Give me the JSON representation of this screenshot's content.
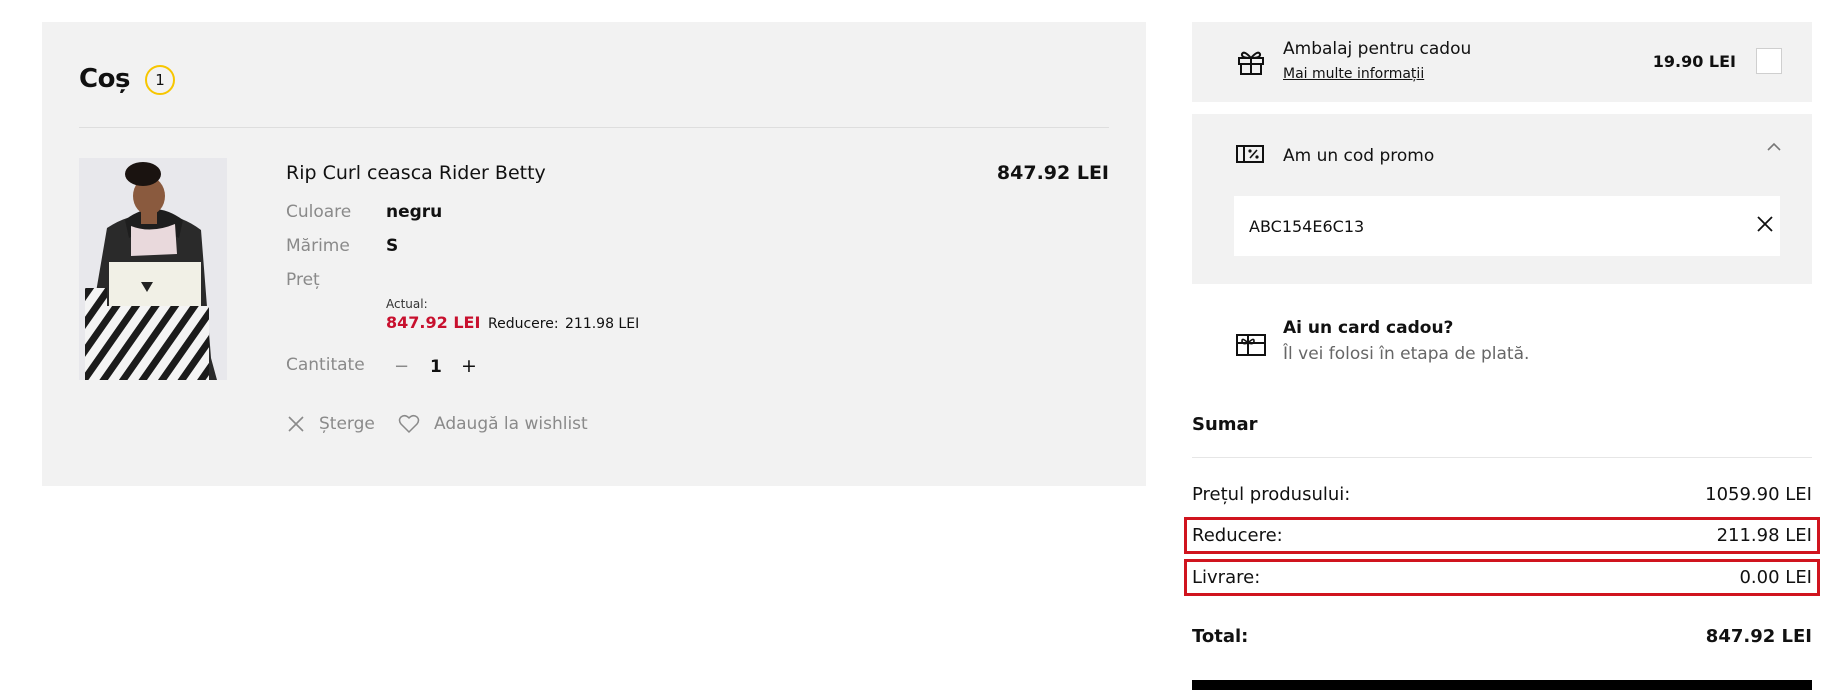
{
  "cart": {
    "title": "Coș",
    "count": "1",
    "item": {
      "name": "Rip Curl ceasca Rider Betty",
      "price": "847.92 LEI",
      "color_label": "Culoare",
      "color_value": "negru",
      "size_label": "Mărime",
      "size_value": "S",
      "price_label": "Preț",
      "actual_caption": "Actual:",
      "actual_price": "847.92 LEI",
      "discount_label": "Reducere:",
      "discount_value": "211.98 LEI",
      "qty_label": "Cantitate",
      "qty_minus": "−",
      "qty_value": "1",
      "qty_plus": "+"
    },
    "actions": {
      "delete_label": "Șterge",
      "wishlist_label": "Adaugă la wishlist"
    }
  },
  "gift_wrap": {
    "title": "Ambalaj pentru cadou",
    "more_link": "Mai multe informații",
    "price": "19.90 LEI",
    "checked": false
  },
  "promo": {
    "title": "Am un cod promo",
    "code_value": "ABC154E6C13",
    "expanded": true
  },
  "gift_card": {
    "title": "Ai un card cadou?",
    "subtitle": "Îl vei folosi în etapa de plată."
  },
  "summary": {
    "title": "Sumar",
    "product_price_label": "Prețul produsului:",
    "product_price_value": "1059.90 LEI",
    "discount_label": "Reducere:",
    "discount_value": "211.98 LEI",
    "shipping_label": "Livrare:",
    "shipping_value": "0.00 LEI",
    "total_label": "Total:",
    "total_value": "847.92 LEI"
  },
  "colors": {
    "accent_yellow": "#f7c600",
    "sale_red": "#c8102e",
    "highlight_red": "#d0141e",
    "panel_gray": "#f2f2f2"
  },
  "icons": [
    "gift-icon",
    "promo-ticket-icon",
    "chevron-up-icon",
    "close-icon",
    "gift-card-icon",
    "x-icon",
    "heart-icon"
  ]
}
